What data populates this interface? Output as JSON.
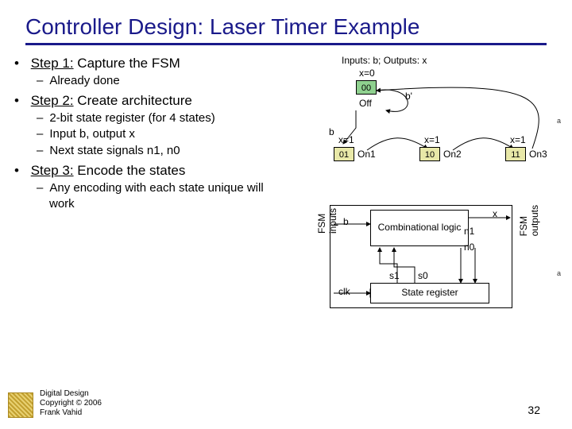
{
  "title": "Controller Design: Laser Timer Example",
  "steps": {
    "s1": {
      "label": "Step 1:",
      "text": "Capture the FSM",
      "sub1": "Already done"
    },
    "s2": {
      "label": "Step 2:",
      "text": "Create architecture",
      "sub1": "2-bit state register (for 4 states)",
      "sub2": "Input b, output x",
      "sub3": "Next state signals n1, n0"
    },
    "s3": {
      "label": "Step 3:",
      "text": "Encode the states",
      "sub1": "Any encoding with each state unique will work"
    }
  },
  "fsm": {
    "inputs_line": "Inputs: b; Outputs: x",
    "x0": "x=0",
    "x1a": "x=1",
    "x1b": "x=1",
    "x1c": "x=1",
    "s00": "00",
    "s01": "01",
    "s10": "10",
    "s11": "11",
    "off": "Off",
    "on1": "On1",
    "on2": "On2",
    "on3": "On3",
    "b": "b",
    "bprime": "b'"
  },
  "arch": {
    "fsm_inputs": "FSM\ninputs",
    "fsm_outputs": "FSM\noutputs",
    "b": "b",
    "x": "x",
    "comb": "Combinational\nlogic",
    "n1": "n1",
    "n0": "n0",
    "s1": "s1",
    "s0": "s0",
    "clk": "clk",
    "state_reg": "State register"
  },
  "annot": {
    "a1": "a",
    "a2": "a"
  },
  "footer": {
    "l1": "Digital Design",
    "l2": "Copyright © 2006",
    "l3": "Frank Vahid"
  },
  "pagenum": "32"
}
